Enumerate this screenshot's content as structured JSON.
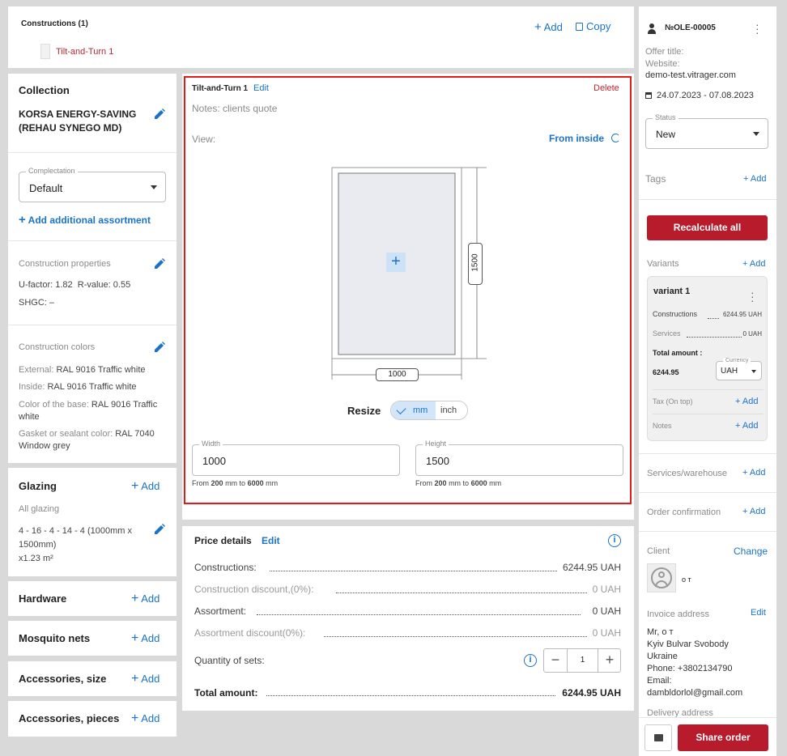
{
  "constructions": {
    "title": "Constructions (1)",
    "add": "Add",
    "copy": "Copy",
    "item": "Tilt-and-Turn 1"
  },
  "left": {
    "collection": {
      "title": "Collection",
      "name": "KORSA ENERGY-SAVING (REHAU SYNEGO MD)",
      "complectation_label": "Complectation",
      "complectation_value": "Default",
      "add_assortment": "Add additional assortment"
    },
    "properties": {
      "title": "Construction properties",
      "ufactor": "U-factor: 1.82",
      "rvalue": "R-value: 0.55",
      "shgc": "SHGC: –"
    },
    "colors": {
      "title": "Construction colors",
      "external_label": "External:",
      "external_value": "RAL 9016 Traffic white",
      "inside_label": "Inside:",
      "inside_value": "RAL 9016 Traffic white",
      "base_label": "Color of the base:",
      "base_value": "RAL 9016 Traffic white",
      "gasket_label": "Gasket or sealant color:",
      "gasket_value": "RAL 7040 Window grey"
    },
    "glazing": {
      "title": "Glazing",
      "add": "Add",
      "all": "All glazing",
      "spec": "4 - 16 - 4 - 14 - 4 (1000mm x 1500mm)",
      "qty": "x1.23 m²"
    },
    "sections": [
      {
        "title": "Hardware",
        "add": "Add"
      },
      {
        "title": "Mosquito nets",
        "add": "Add"
      },
      {
        "title": "Accessories, size",
        "add": "Add"
      },
      {
        "title": "Accessories, pieces",
        "add": "Add"
      }
    ]
  },
  "editor": {
    "name": "Tilt-and-Turn 1",
    "edit": "Edit",
    "delete": "Delete",
    "notes": "Notes: clients quote",
    "view_label": "View:",
    "view_value": "From inside",
    "height_dim": "1500",
    "width_dim": "1000",
    "resize_label": "Resize",
    "unit_mm": "mm",
    "unit_inch": "inch",
    "width_label": "Width",
    "width_value": "1000",
    "height_label": "Height",
    "height_value": "1500",
    "range_from": "From",
    "range_min": "200",
    "range_mid": "mm to",
    "range_max": "6000",
    "range_unit": "mm"
  },
  "price": {
    "title": "Price details",
    "edit": "Edit",
    "rows": [
      {
        "label": "Constructions:",
        "value": "6244.95 UAH",
        "muted": false
      },
      {
        "label": "Construction discount,(0%):",
        "value": "0 UAH",
        "muted": true
      },
      {
        "label": "Assortment:",
        "value": "0 UAH",
        "muted": false
      },
      {
        "label": "Assortment discount(0%):",
        "value": "0 UAH",
        "muted": true
      }
    ],
    "quantity_label": "Quantity of sets:",
    "quantity_value": "1",
    "total_label": "Total amount:",
    "total_value": "6244.95 UAH"
  },
  "right": {
    "order_no": "№OLE-00005",
    "offer_title": "Offer title:",
    "website_label": "Website:",
    "website_value": "demo-test.vitrager.com",
    "dates": "24.07.2023 - 07.08.2023",
    "status_label": "Status",
    "status_value": "New",
    "tags": "Tags",
    "add": "Add",
    "recalculate": "Recalculate all",
    "variants": "Variants",
    "variant": {
      "name": "variant 1",
      "constructions_label": "Constructions",
      "constructions_value": "6244.95 UAH",
      "services_label": "Services",
      "services_value": "0 UAH",
      "total_label": "Total amount :",
      "total_value": "6244.95",
      "currency_label": "Currency",
      "currency_value": "UAH",
      "tax_label": "Tax (On top)",
      "notes_label": "Notes"
    },
    "services_warehouse": "Services/warehouse",
    "order_confirmation": "Order confirmation",
    "client": "Client",
    "change": "Change",
    "client_name": "о т",
    "invoice_address": "Invoice address",
    "edit": "Edit",
    "address_lines": [
      "Mr, о т",
      "Kyiv Bulvar Svobody",
      "Ukraine",
      "Phone: +3802134790",
      "Email:",
      "dambldorlol@gmail.com"
    ],
    "delivery_address": "Delivery address",
    "share_order": "Share order"
  }
}
